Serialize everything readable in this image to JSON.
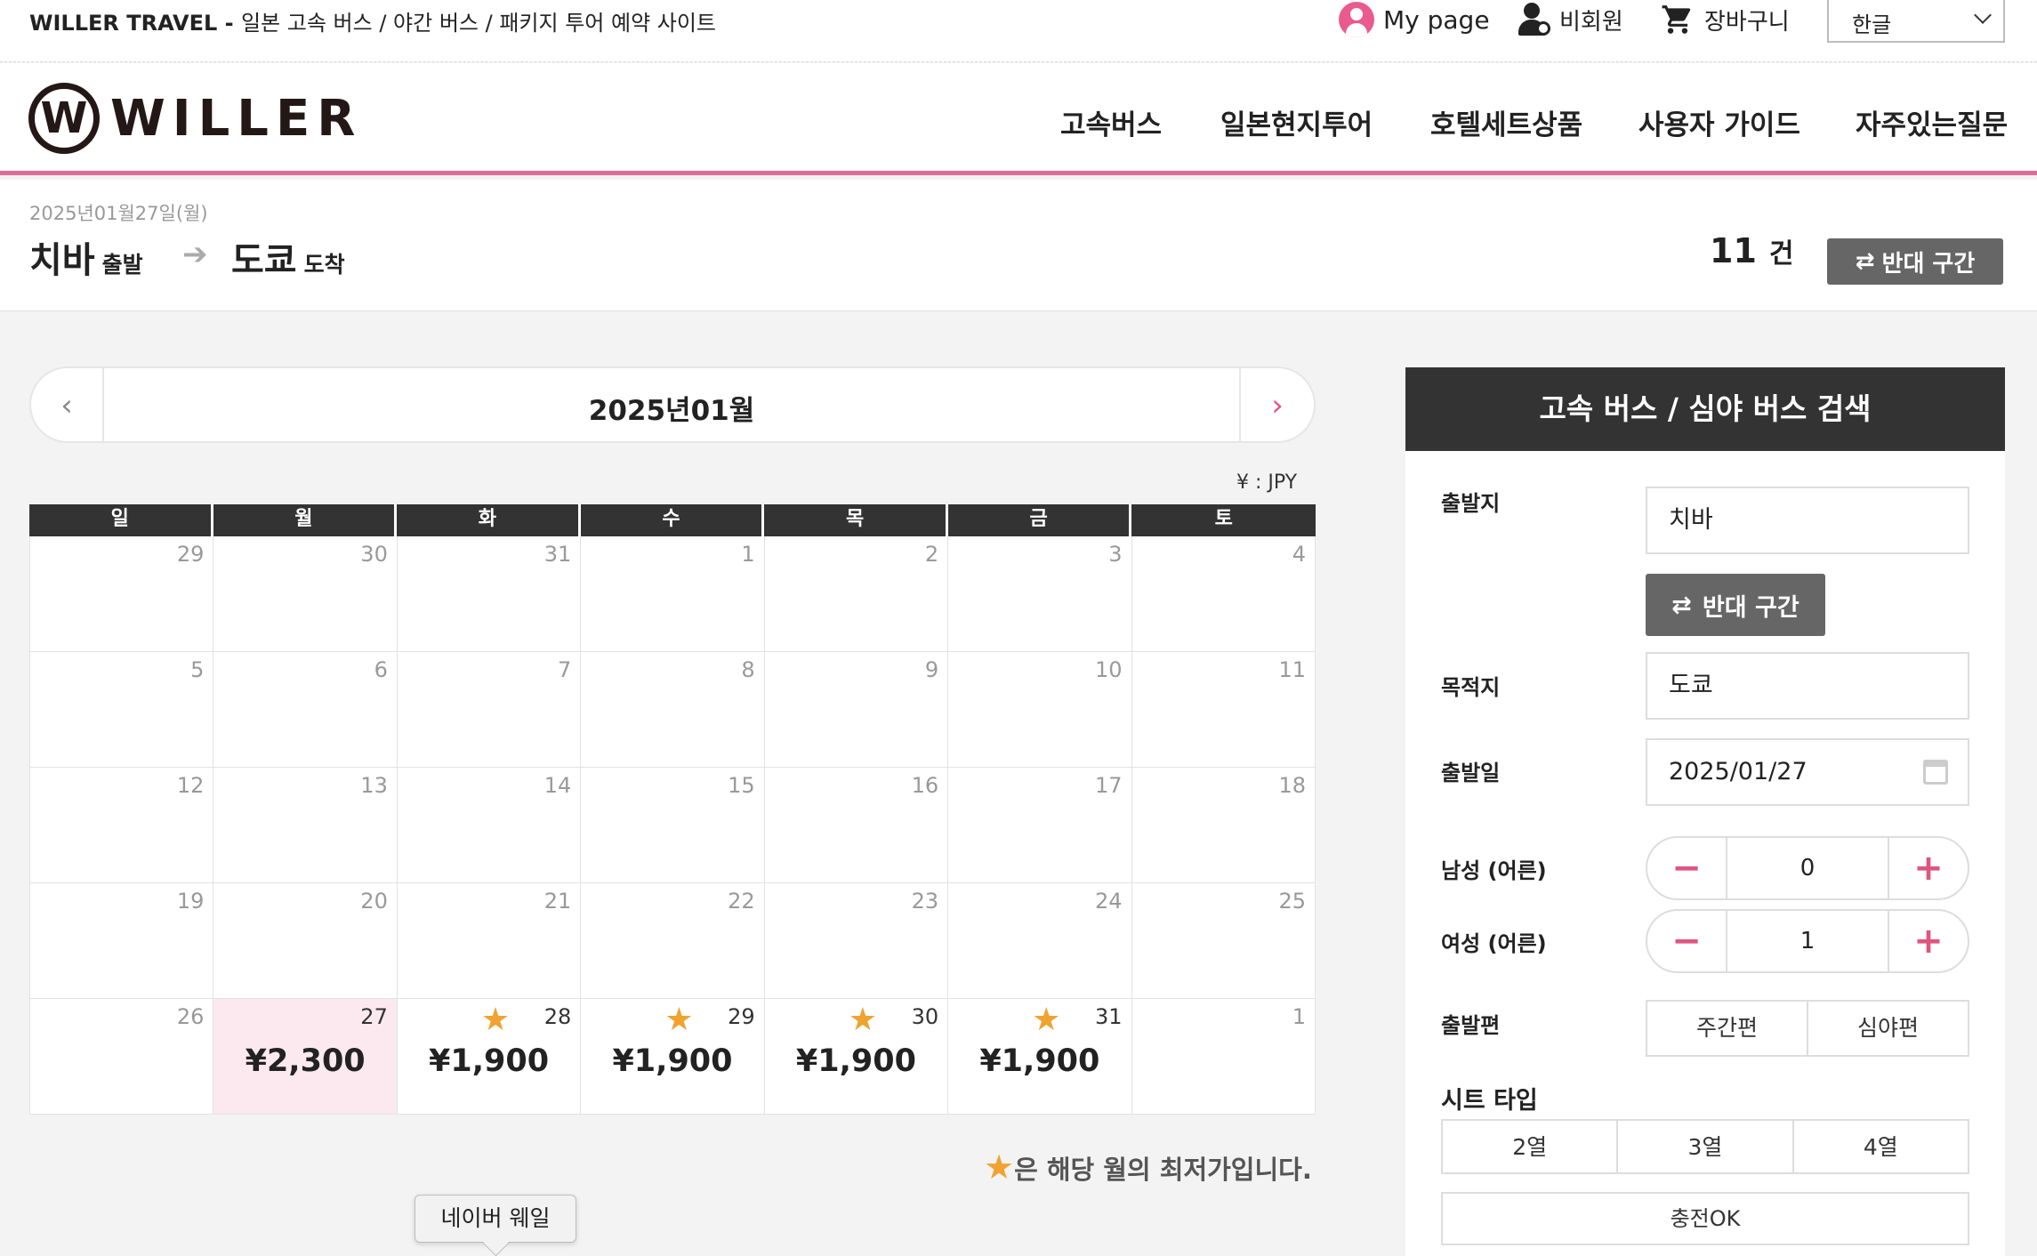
{
  "topbar": {
    "brand": "WILLER TRAVEL - ",
    "tagline": "일본 고속 버스 / 야간 버스 / 패키지 투어 예약 사이트",
    "mypage": "My page",
    "guest": "비회원",
    "cart": "장바구니",
    "language": "한글"
  },
  "header": {
    "logo_text": "WILLER",
    "nav": [
      "고속버스",
      "일본현지투어",
      "호텔세트상품",
      "사용자 가이드",
      "자주있는질문"
    ]
  },
  "route": {
    "date": "2025년01월27일(월)",
    "from": "치바",
    "from_suffix": "출발",
    "to": "도쿄",
    "to_suffix": "도착",
    "count": "11",
    "count_unit": "건",
    "reverse_label": "반대 구간"
  },
  "calendar": {
    "month_title": "2025년01월",
    "currency": "¥ : JPY",
    "weekdays": [
      "일",
      "월",
      "화",
      "수",
      "목",
      "금",
      "토"
    ],
    "days": [
      {
        "d": "29"
      },
      {
        "d": "30"
      },
      {
        "d": "31"
      },
      {
        "d": "1"
      },
      {
        "d": "2"
      },
      {
        "d": "3"
      },
      {
        "d": "4"
      },
      {
        "d": "5"
      },
      {
        "d": "6"
      },
      {
        "d": "7"
      },
      {
        "d": "8"
      },
      {
        "d": "9"
      },
      {
        "d": "10"
      },
      {
        "d": "11"
      },
      {
        "d": "12"
      },
      {
        "d": "13"
      },
      {
        "d": "14"
      },
      {
        "d": "15"
      },
      {
        "d": "16"
      },
      {
        "d": "17"
      },
      {
        "d": "18"
      },
      {
        "d": "19"
      },
      {
        "d": "20"
      },
      {
        "d": "21"
      },
      {
        "d": "22"
      },
      {
        "d": "23"
      },
      {
        "d": "24"
      },
      {
        "d": "25"
      },
      {
        "d": "26"
      },
      {
        "d": "27",
        "price": "¥2,300",
        "selected": true
      },
      {
        "d": "28",
        "price": "¥1,900",
        "star": true
      },
      {
        "d": "29",
        "price": "¥1,900",
        "star": true
      },
      {
        "d": "30",
        "price": "¥1,900",
        "star": true
      },
      {
        "d": "31",
        "price": "¥1,900",
        "star": true
      },
      {
        "d": "1"
      }
    ],
    "note_star": "★",
    "note_text": "은 해당 월의 최저가입니다.",
    "tooltip": "네이버 웨일"
  },
  "search": {
    "title": "고속 버스 / 심야 버스 검색",
    "departure_label": "출발지",
    "departure_value": "치바",
    "reverse_label": "반대 구간",
    "destination_label": "목적지",
    "destination_value": "도쿄",
    "date_label": "출발일",
    "date_value": "2025/01/27",
    "male_label": "남성 (어른)",
    "male_value": "0",
    "female_label": "여성 (어른)",
    "female_value": "1",
    "time_label": "출발편",
    "time_options": [
      "주간편",
      "심야편"
    ],
    "seat_label": "시트 타입",
    "seat_options": [
      "2열",
      "3열",
      "4열"
    ],
    "charge_label": "충전OK"
  },
  "colors": {
    "accent": "#e0557f",
    "dark": "#333333",
    "star": "#f0a330",
    "selected_bg": "#fbe9ef"
  }
}
